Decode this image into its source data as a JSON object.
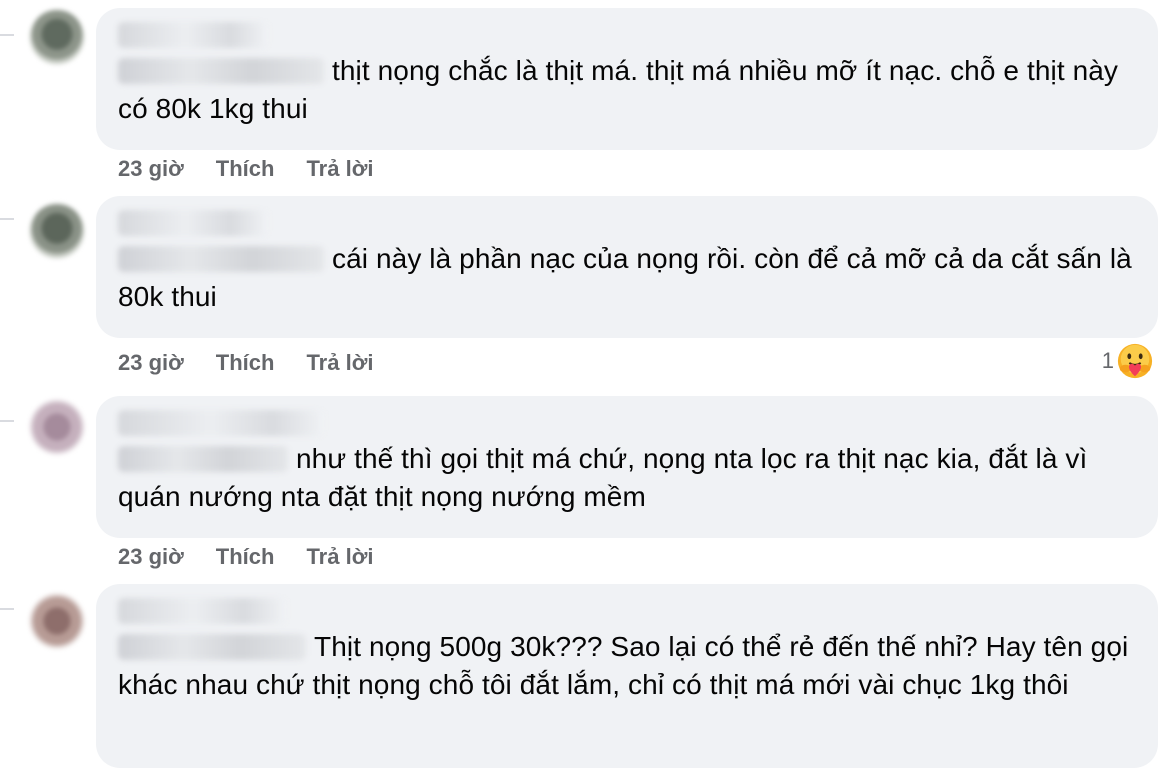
{
  "comments": [
    {
      "text": "thịt nọng chắc là thịt má. thịt má nhiều mỡ ít nạc. chỗ e thịt này có 80k 1kg thui",
      "time": "23 giờ",
      "like_label": "Thích",
      "reply_label": "Trả lời"
    },
    {
      "text": "cái này là phần nạc của nọng rồi. còn để cả mỡ cả da cắt sấn là 80k thui",
      "time": "23 giờ",
      "like_label": "Thích",
      "reply_label": "Trả lời",
      "reaction": {
        "count": "1",
        "icon": "care-reaction-icon"
      }
    },
    {
      "text": "như thế thì gọi thịt má chứ, nọng nta lọc ra thịt nạc kia, đắt là vì quán nướng nta đặt thịt nọng nướng mềm",
      "time": "23 giờ",
      "like_label": "Thích",
      "reply_label": "Trả lời"
    },
    {
      "text": "Thịt nọng 500g 30k??? Sao lại có thể rẻ đến thế nhỉ? Hay tên gọi khác nhau chứ thịt nọng chỗ tôi đắt lắm, chỉ có thịt má mới vài chục 1kg thôi"
    }
  ],
  "colors": {
    "bubble": "#f0f2f5",
    "text": "#050505",
    "meta": "#65676b"
  }
}
